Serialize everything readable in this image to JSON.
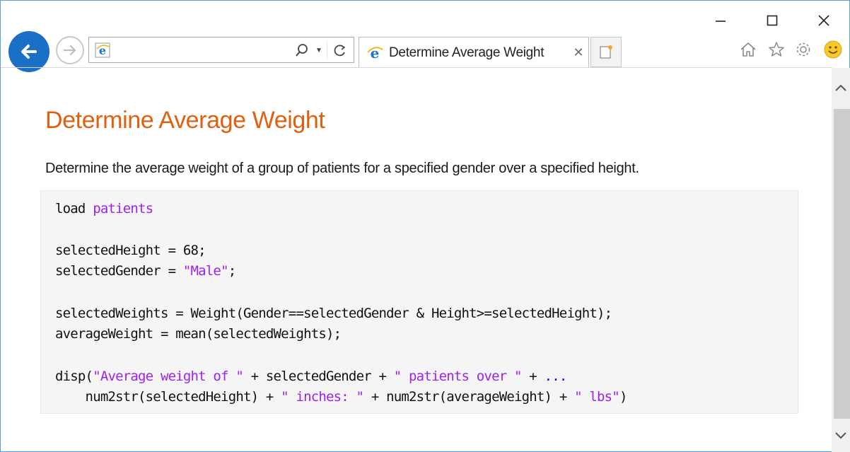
{
  "window": {
    "controls": {
      "minimize": "minimize",
      "maximize": "maximize",
      "close": "close"
    }
  },
  "navigation": {
    "back_icon": "back-arrow-icon",
    "forward_icon": "forward-arrow-icon"
  },
  "address_bar": {
    "value": "",
    "icons": [
      "ie-icon",
      "search-icon",
      "chevron-down-icon",
      "refresh-icon"
    ]
  },
  "tab": {
    "title": "Determine Average Weight",
    "close_glyph": "✕"
  },
  "toolbar": {
    "icons": [
      "home-icon",
      "star-icon",
      "gear-icon",
      "smiley-icon"
    ]
  },
  "page": {
    "heading": "Determine Average Weight",
    "description": "Determine the average weight of a group of patients for a specified gender over a specified height."
  },
  "code": {
    "line1": {
      "a": "load ",
      "b": "patients"
    },
    "line2": {
      "a": "selectedHeight = 68;"
    },
    "line3": {
      "a": "selectedGender = ",
      "b": "\"Male\"",
      "c": ";"
    },
    "line4": {
      "a": "selectedWeights = Weight(Gender==selectedGender & Height>=selectedHeight);"
    },
    "line5": {
      "a": "averageWeight = mean(selectedWeights);"
    },
    "line6": {
      "a": "disp(",
      "b": "\"Average weight of \"",
      "c": " + selectedGender + ",
      "d": "\" patients over \"",
      "e": " + ",
      "f": "..."
    },
    "line7": {
      "a": "    num2str(selectedHeight) + ",
      "b": "\" inches: \"",
      "c": " + num2str(averageWeight) + ",
      "d": "\" lbs\"",
      "e": ")"
    }
  },
  "colors": {
    "heading": "#e0600f",
    "string": "#a020f0",
    "continuation": "#0000ff",
    "back_button": "#1a6fc7",
    "code_background": "#f5f5f5"
  }
}
